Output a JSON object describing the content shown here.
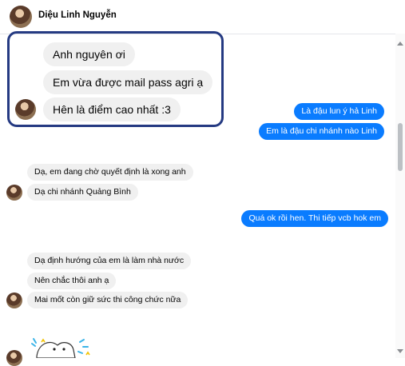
{
  "header": {
    "contact_name": "Diệu Linh Nguyễn"
  },
  "messages": {
    "m1": "Anh nguyên ơi",
    "m2": "Em vừa được mail pass agri ạ",
    "m3": "Hên là điểm cao nhất :3",
    "m4": "Là đậu lun ý hả Linh",
    "m5": "Em là đậu chi nhánh nào Linh",
    "m6": "Dạ, em đang chờ quyết định là xong anh",
    "m7": "Dạ chi nhánh Quảng Bình",
    "m8": "Quá ok rồi hen. Thi tiếp vcb hok em",
    "m9": "Dạ định hướng của em là làm nhà nước",
    "m10": "Nên chắc thôi anh ạ",
    "m11": "Mai mốt còn giữ sức thi công chức nữa"
  },
  "colors": {
    "outgoing_bubble": "#0a7cff",
    "incoming_bubble": "#f0f0f0",
    "highlight_frame": "#253a82"
  },
  "icons": {
    "avatar": "profile-photo",
    "sticker": "bunny-sticker"
  }
}
